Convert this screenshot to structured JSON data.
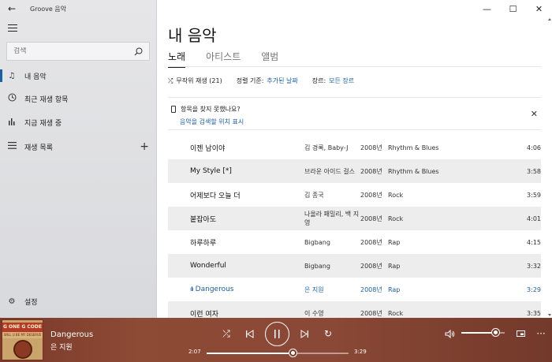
{
  "window": {
    "title": "Groove 음악"
  },
  "sidebar": {
    "search_placeholder": "검색",
    "items": [
      {
        "label": "내 음악",
        "icon": "music-note-icon"
      },
      {
        "label": "최근 재생 항목",
        "icon": "clock-icon"
      },
      {
        "label": "지금 재생 중",
        "icon": "equalizer-icon"
      },
      {
        "label": "재생 목록",
        "icon": "list-icon"
      }
    ],
    "settings_label": "설정"
  },
  "main": {
    "title": "내 음악",
    "tabs": [
      "노래",
      "아티스트",
      "앨범"
    ],
    "active_tab": 0,
    "filter": {
      "shuffle_label": "무작위 재생 (21)",
      "sort_prefix": "정렬 기준:",
      "sort_value": "추가된 날짜",
      "genre_prefix": "장르:",
      "genre_value": "모든 장르"
    },
    "notice": {
      "text": "항목을 찾지 못했나요?",
      "link": "음악을 검색할 위치 표시"
    },
    "songs": [
      {
        "title": "이젠 남이야",
        "artist": "김 경록, Baby-J",
        "year": "2008년",
        "genre": "Rhythm & Blues",
        "duration": "4:06"
      },
      {
        "title": "My Style [*]",
        "artist": "브라운 아이드 걸스",
        "year": "2008년",
        "genre": "Rhythm & Blues",
        "duration": "3:58"
      },
      {
        "title": "어제보다 오늘 더",
        "artist": "김 종국",
        "year": "2008년",
        "genre": "Rock",
        "duration": "3:59"
      },
      {
        "title": "붙잡아도",
        "artist": "나올라 패밀리, 백 지영",
        "year": "2008년",
        "genre": "Rock",
        "duration": "4:01"
      },
      {
        "title": "하루하루",
        "artist": "Bigbang",
        "year": "2008년",
        "genre": "Rap",
        "duration": "4:15"
      },
      {
        "title": "Wonderful",
        "artist": "Bigbang",
        "year": "2008년",
        "genre": "Rap",
        "duration": "3:32"
      },
      {
        "title": "Dangerous",
        "artist": "은 지원",
        "year": "2008년",
        "genre": "Rap",
        "duration": "3:29"
      },
      {
        "title": "이런 여자",
        "artist": "이 수영",
        "year": "2008년",
        "genre": "Rock",
        "duration": "3:35"
      }
    ],
    "playing_index": 6
  },
  "player": {
    "title": "Dangerous",
    "artist": "은 지원",
    "album_art_text": "G ONE G CODE",
    "album_art_subtext": "WILL U BE MY DESERVE",
    "elapsed": "2:07",
    "total": "3:29",
    "progress": 0.61,
    "volume": 0.8
  },
  "colors": {
    "accent": "#1a5fa8",
    "player_bg": "#8a4836"
  }
}
